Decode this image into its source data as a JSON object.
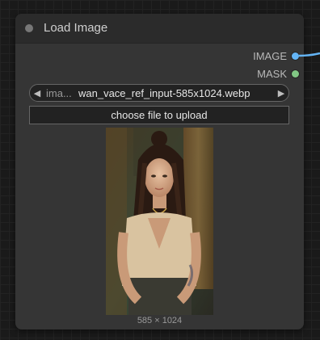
{
  "node": {
    "title": "Load Image",
    "outputs": [
      {
        "label": "IMAGE",
        "color": "#64b5f6"
      },
      {
        "label": "MASK",
        "color": "#81c784"
      }
    ],
    "image_combo": {
      "name": "ima...",
      "value": "wan_vace_ref_input-585x1024.webp",
      "left_arrow": "◀",
      "right_arrow": "▶"
    },
    "upload_button_label": "choose file to upload",
    "preview": {
      "description_icon": "portrait-image",
      "size_label": "585 × 1024"
    }
  },
  "colors": {
    "canvas_bg": "#1a1a1a",
    "node_bg": "#353535",
    "header_bg": "#2b2b2b",
    "image_link": "#64b5f6",
    "mask_link": "#81c784"
  }
}
